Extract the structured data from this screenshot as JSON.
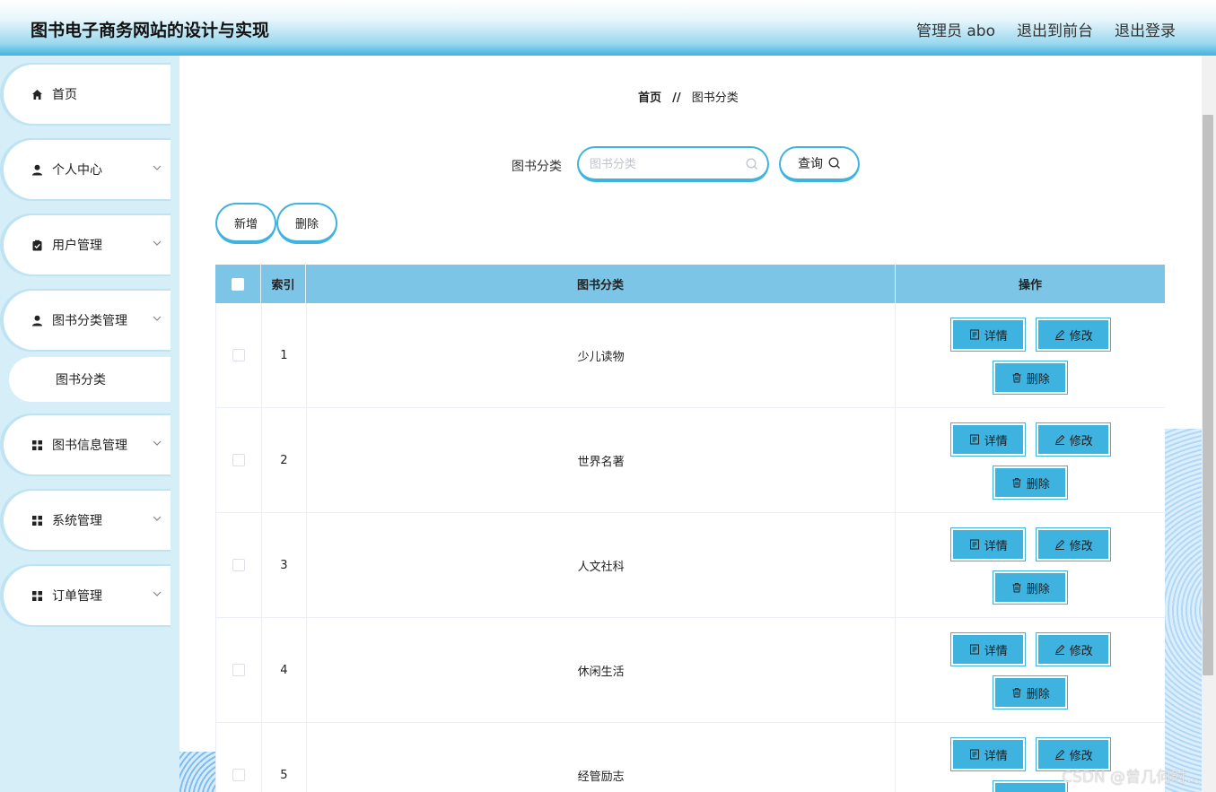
{
  "header": {
    "title": "图书电子商务网站的设计与实现",
    "admin": "管理员 abo",
    "to_front": "退出到前台",
    "logout": "退出登录"
  },
  "sidebar": {
    "items": [
      {
        "label": "首页",
        "icon": "home-icon"
      },
      {
        "label": "个人中心",
        "icon": "user-icon"
      },
      {
        "label": "用户管理",
        "icon": "clipboard-icon"
      },
      {
        "label": "图书分类管理",
        "icon": "user-icon"
      },
      {
        "label": "图书信息管理",
        "icon": "grid-icon"
      },
      {
        "label": "系统管理",
        "icon": "grid-icon"
      },
      {
        "label": "订单管理",
        "icon": "grid-icon"
      }
    ],
    "sub_item": "图书分类"
  },
  "breadcrumb": {
    "home": "首页",
    "sep": "//",
    "current": "图书分类"
  },
  "search": {
    "label": "图书分类",
    "placeholder": "图书分类",
    "query_label": "查询"
  },
  "actions": {
    "add": "新增",
    "delete": "删除"
  },
  "table": {
    "headers": [
      "",
      "索引",
      "图书分类",
      "操作"
    ],
    "rows": [
      {
        "index": "1",
        "category": "少儿读物"
      },
      {
        "index": "2",
        "category": "世界名著"
      },
      {
        "index": "3",
        "category": "人文社科"
      },
      {
        "index": "4",
        "category": "休闲生活"
      },
      {
        "index": "5",
        "category": "经管励志"
      }
    ],
    "op_detail": "详情",
    "op_edit": "修改",
    "op_delete": "删除"
  },
  "colors": {
    "accent": "#3fb3e0",
    "table_header": "#7dc5e6",
    "sidebar_bg": "#d5eef8"
  },
  "watermark": "CSDN @曾几何时…"
}
